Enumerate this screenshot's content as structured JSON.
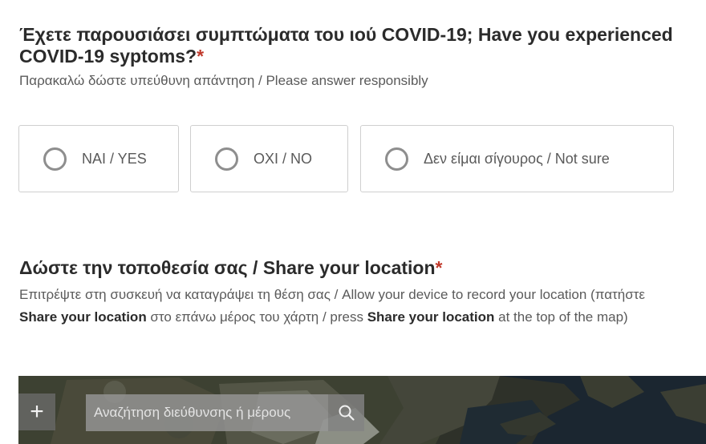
{
  "question_symptoms": {
    "title": "Έχετε παρουσιάσει συμπτώματα του ιού COVID-19; Have you experienced COVID-19 syptoms?",
    "required_mark": "*",
    "description": "Παρακαλώ δώστε υπεύθυνη απάντηση / Please answer responsibly",
    "options": [
      {
        "label": "NAI / YES",
        "selected": false
      },
      {
        "label": "OXI / NO",
        "selected": false
      },
      {
        "label": "Δεν είμαι σίγουρος / Not sure",
        "selected": false
      }
    ]
  },
  "question_location": {
    "title": "Δώστε την τοποθεσία σας / Share your location",
    "required_mark": "*",
    "description": {
      "part1": "Επιτρέψτε στη συσκευή να καταγράψει τη θέση σας / Allow your device to record your location (πατήστε ",
      "bold1": "Share your location",
      "part2": " στο επάνω μέρος του χάρτη / press ",
      "bold2": "Share your location",
      "part3": " at the top of the map)"
    }
  },
  "map": {
    "zoom_in_symbol": "+",
    "search_placeholder": "Αναζήτηση διεύθυνσης ή μέρους",
    "search_value": "",
    "search_icon": "search-icon",
    "zoom_icon": "plus-icon"
  },
  "colors": {
    "required": "#c0392b",
    "radio_border": "#8e8e8e",
    "option_border": "#cfcfcf"
  }
}
